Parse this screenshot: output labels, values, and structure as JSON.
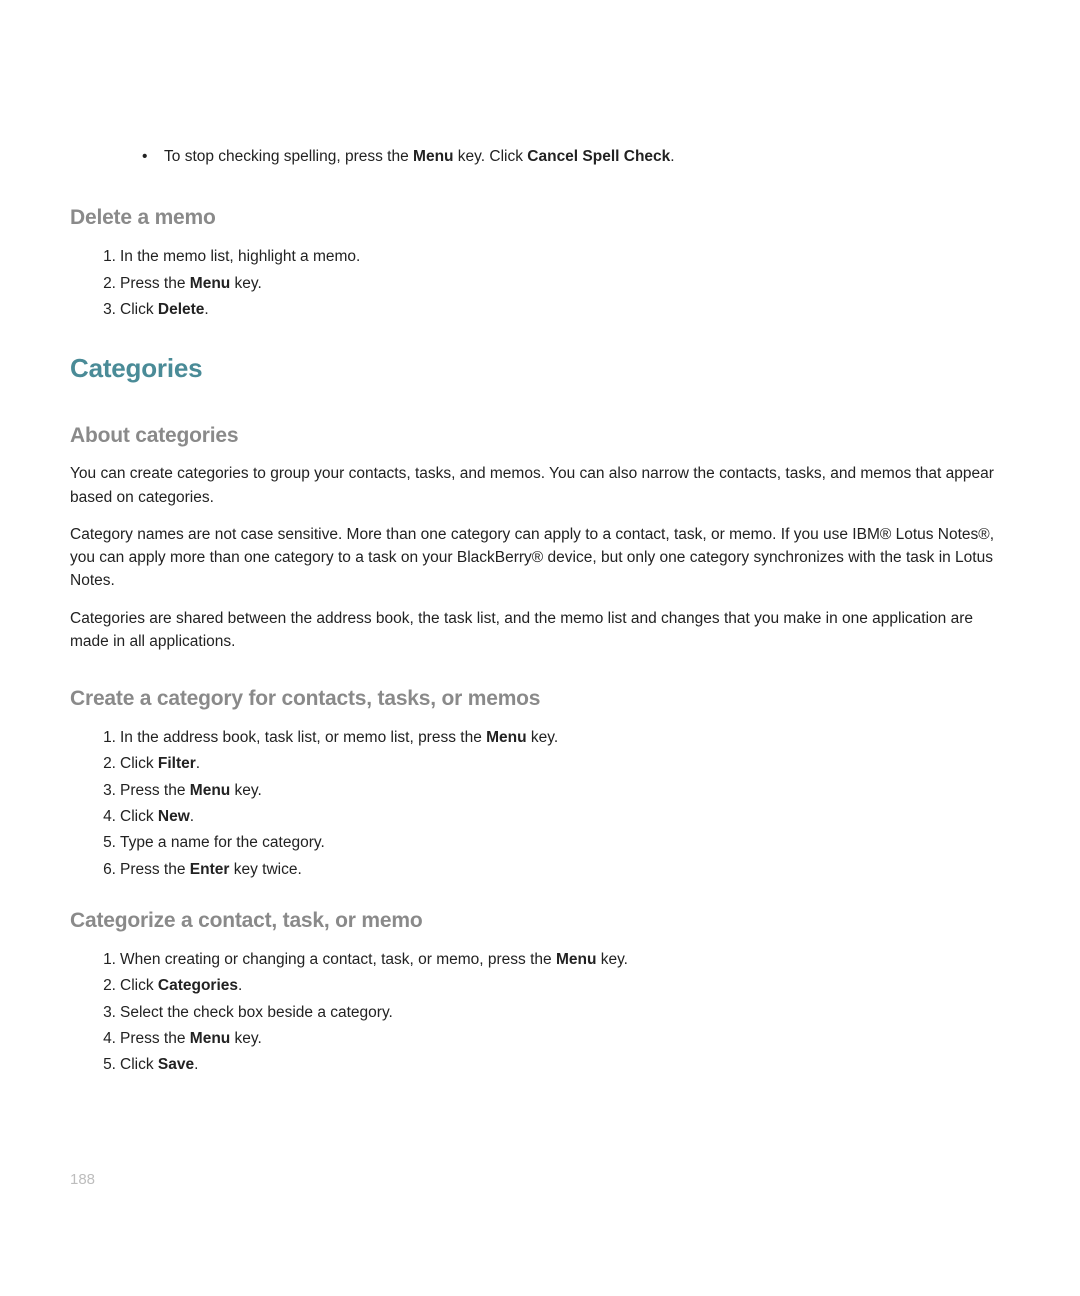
{
  "spell": {
    "prefix": "To stop checking spelling, press the ",
    "menu": "Menu",
    "mid": " key. Click ",
    "cancel": "Cancel Spell Check",
    "end": "."
  },
  "deleteMemo": {
    "heading": "Delete a memo",
    "steps": [
      {
        "n": "1.",
        "t1": "In the memo list, highlight a memo."
      },
      {
        "n": "2.",
        "t1": "Press the ",
        "b": "Menu",
        "t2": " key."
      },
      {
        "n": "3.",
        "t1": "Click ",
        "b": "Delete",
        "t2": "."
      }
    ]
  },
  "categoriesHeading": "Categories",
  "about": {
    "heading": "About categories",
    "p1": "You can create categories to group your contacts, tasks, and memos. You can also narrow the contacts, tasks, and memos that appear based on categories.",
    "p2": "Category names are not case sensitive. More than one category can apply to a contact, task, or memo. If you use IBM® Lotus Notes®, you can apply more than one category to a task on your BlackBerry® device, but only one category synchronizes with the task in Lotus Notes.",
    "p3": "Categories are shared between the address book, the task list, and the memo list and changes that you make in one application are made in all applications."
  },
  "create": {
    "heading": "Create a category for contacts, tasks, or memos",
    "steps": [
      {
        "n": "1.",
        "t1": "In the address book, task list, or memo list, press the ",
        "b": "Menu",
        "t2": " key."
      },
      {
        "n": "2.",
        "t1": "Click ",
        "b": "Filter",
        "t2": "."
      },
      {
        "n": "3.",
        "t1": "Press the ",
        "b": "Menu",
        "t2": " key."
      },
      {
        "n": "4.",
        "t1": "Click ",
        "b": "New",
        "t2": "."
      },
      {
        "n": "5.",
        "t1": "Type a name for the category."
      },
      {
        "n": "6.",
        "t1": "Press the ",
        "b": "Enter",
        "t2": " key twice."
      }
    ]
  },
  "categorize": {
    "heading": "Categorize a contact, task, or memo",
    "steps": [
      {
        "n": "1.",
        "t1": "When creating or changing a contact, task, or memo, press the ",
        "b": "Menu",
        "t2": " key."
      },
      {
        "n": "2.",
        "t1": "Click ",
        "b": "Categories",
        "t2": "."
      },
      {
        "n": "3.",
        "t1": "Select the check box beside a category."
      },
      {
        "n": "4.",
        "t1": "Press the ",
        "b": "Menu",
        "t2": " key."
      },
      {
        "n": "5.",
        "t1": "Click ",
        "b": "Save",
        "t2": "."
      }
    ]
  },
  "pageNumber": "188"
}
